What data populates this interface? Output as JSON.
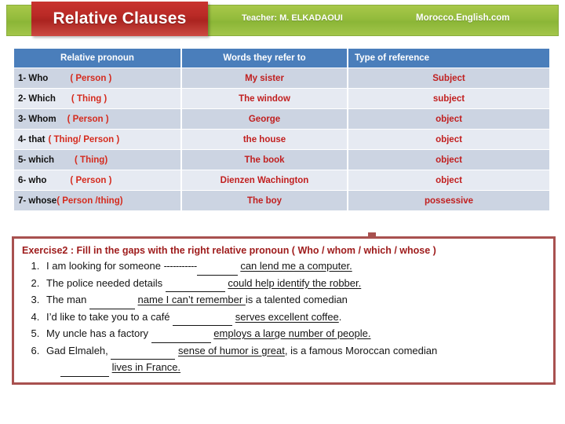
{
  "header": {
    "title": "Relative Clauses",
    "teacher": "Teacher: M. ELKADAOUI",
    "site": "Morocco.English.com",
    "colors": {
      "green": "#93bb3c",
      "red_plate": "#b92a26",
      "title_text": "#ffffff"
    }
  },
  "table": {
    "headers": {
      "col1": "Relative pronoun",
      "col2": "Words they refer  to",
      "col3": "Type of reference"
    },
    "header_bg": "#4a7ebb",
    "row_bg_odd": "#ccd4e2",
    "row_bg_even": "#e6eaf2",
    "value_color": "#c11f1f",
    "rows": [
      {
        "num": "1-  Who",
        "kind": "( Person )",
        "refers": "My sister",
        "type": "Subject"
      },
      {
        "num": "2- Which",
        "kind": "( Thing )",
        "refers": "The window",
        "type": "subject"
      },
      {
        "num": "3- Whom",
        "kind": "( Person )",
        "refers": "George",
        "type": "object"
      },
      {
        "num": "4- that",
        "kind": "( Thing/ Person )",
        "refers": "the house",
        "type": "object"
      },
      {
        "num": "5- which",
        "kind": "( Thing)",
        "refers": "The book",
        "type": "object"
      },
      {
        "num": "6- who",
        "kind": "( Person )",
        "refers": "Dienzen Wachington",
        "type": "object"
      },
      {
        "num": "7- whose",
        "kind": "( Person /thing)",
        "refers": "The boy",
        "type": "possessive"
      }
    ]
  },
  "exercise": {
    "title": "Exercise2 : Fill in the gaps with the right relative pronoun  ( Who / whom / which / whose )",
    "border_color": "#a8514f",
    "title_color": "#9e1b1b",
    "items": [
      {
        "pre": "I am looking for someone ",
        "dashes": "-----------",
        "post": "can lend me a computer."
      },
      {
        "pre": "The police needed details ",
        "dashes": "",
        "post": "could help identify the robber."
      },
      {
        "pre": "The man ",
        "dashes": "",
        "post": "name I can’t remember ",
        "tail": "is a talented comedian"
      },
      {
        "pre": "I’d like to take you to a café ",
        "dashes": "",
        "post": "serves excellent coffee",
        "tail": "."
      },
      {
        "pre": "My uncle has a factory ",
        "dashes": "",
        "post": "employs a large number of people."
      },
      {
        "pre": "Gad Elmaleh, ",
        "dashes": "",
        "post": "sense of humor is great",
        "tail": ", is a famous Moroccan comedian",
        "second_post": "lives in France."
      }
    ]
  }
}
